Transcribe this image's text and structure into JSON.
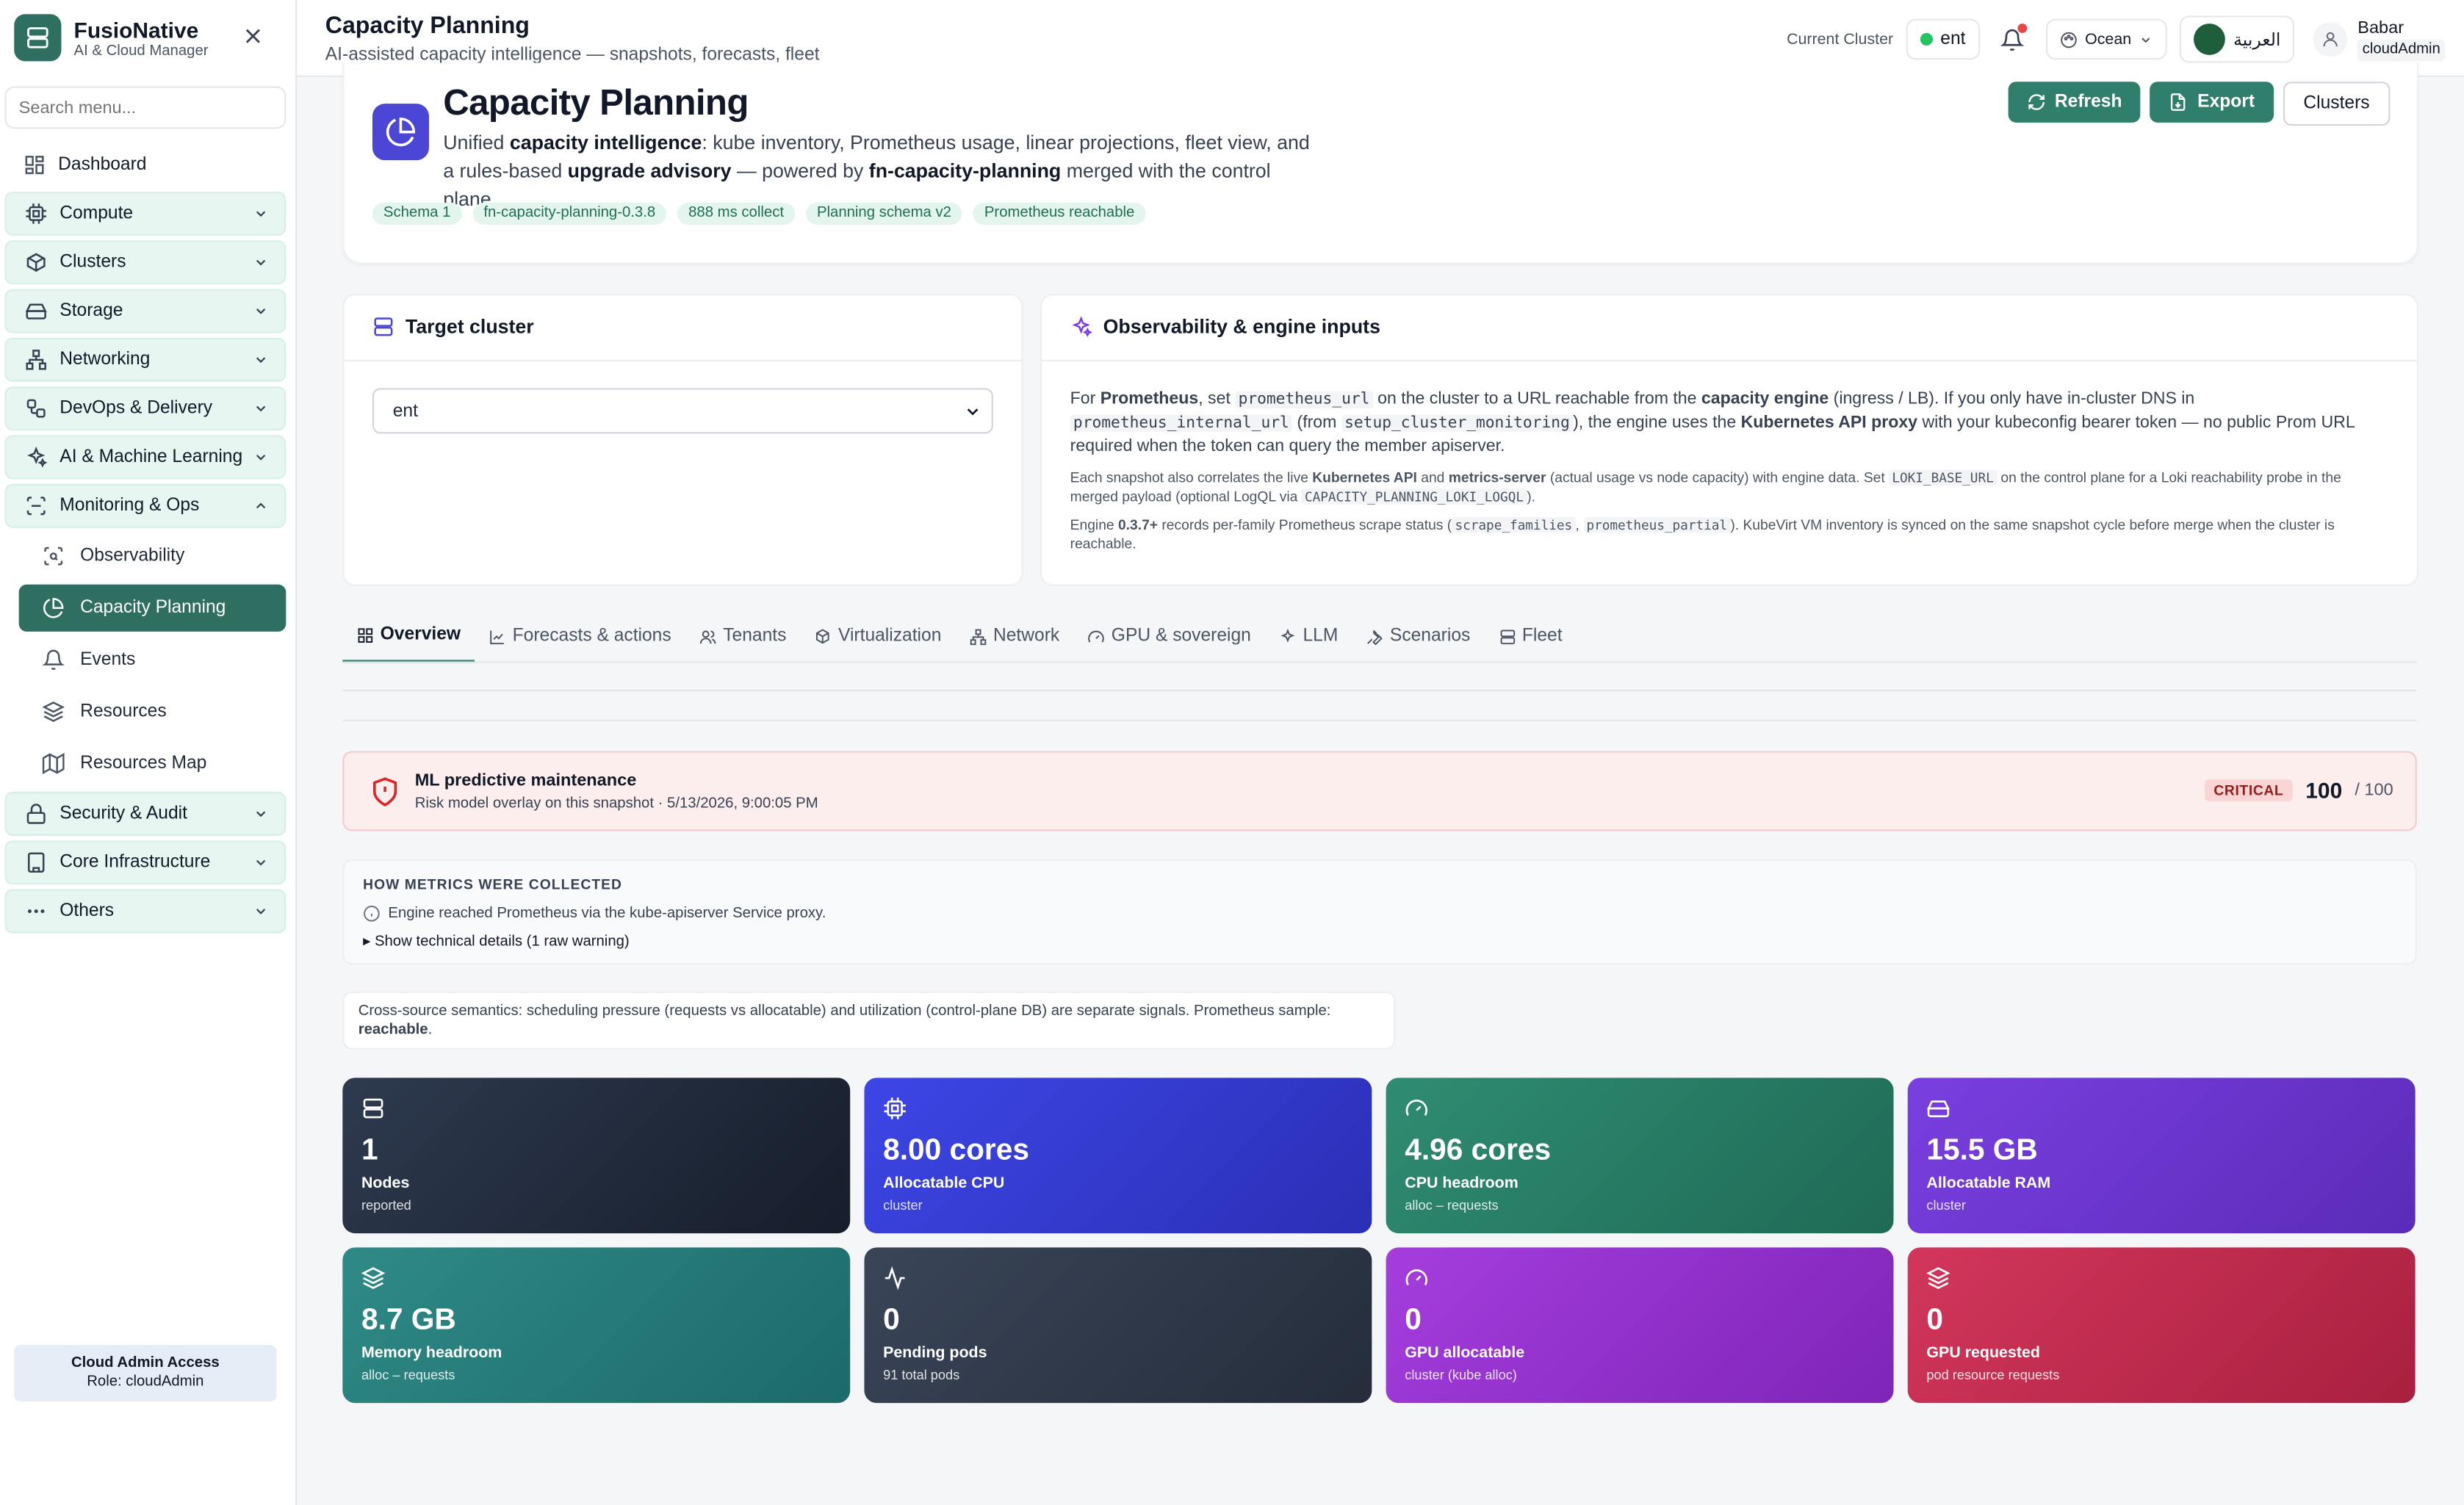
{
  "brand": {
    "name": "FusioNative",
    "subtitle": "AI & Cloud Manager"
  },
  "sidebar": {
    "search_placeholder": "Search menu...",
    "dashboard": "Dashboard",
    "groups": {
      "compute": "Compute",
      "clusters": "Clusters",
      "storage": "Storage",
      "networking": "Networking",
      "devops": "DevOps & Delivery",
      "ai": "AI & Machine Learning",
      "monitoring": "Monitoring & Ops",
      "security": "Security & Audit",
      "core": "Core Infrastructure",
      "others": "Others"
    },
    "sub": {
      "observability": "Observability",
      "capacity": "Capacity Planning",
      "events": "Events",
      "resources": "Resources",
      "resources_map": "Resources Map"
    },
    "admin": {
      "title": "Cloud Admin Access",
      "role": "Role: cloudAdmin"
    }
  },
  "topbar": {
    "title": "Capacity Planning",
    "subtitle": "AI-assisted capacity intelligence — snapshots, forecasts, fleet",
    "cluster_label": "Current Cluster",
    "cluster_value": "ent",
    "theme": "Ocean",
    "lang": "العربية",
    "user_name": "Babar",
    "user_role": "cloudAdmin"
  },
  "header": {
    "title": "Capacity Planning",
    "desc": {
      "t1": "Unified ",
      "b1": "capacity intelligence",
      "t2": ": kube inventory, Prometheus usage, linear projections, fleet view, and a rules-based ",
      "b2": "upgrade advisory",
      "t3": " — powered by ",
      "b3": "fn-capacity-planning",
      "t4": " merged with the control plane."
    },
    "chips": [
      "Schema 1",
      "fn-capacity-planning-0.3.8",
      "888 ms collect",
      "Planning schema v2",
      "Prometheus reachable"
    ],
    "buttons": {
      "refresh": "Refresh",
      "export": "Export",
      "clusters": "Clusters"
    }
  },
  "target": {
    "title": "Target cluster",
    "value": "ent"
  },
  "observability": {
    "title": "Observability & engine inputs",
    "p1": {
      "t1": "For ",
      "b1": "Prometheus",
      "t2": ", set ",
      "c1": "prometheus_url",
      "t3": " on the cluster to a URL reachable from the ",
      "b2": "capacity engine",
      "t4": " (ingress / LB). If you only have in-cluster DNS in ",
      "c2": "prometheus_internal_url",
      "t5": " (from ",
      "c3": "setup_cluster_monitoring",
      "t6": "), the engine uses the ",
      "b3": "Kubernetes API proxy",
      "t7": " with your kubeconfig bearer token — no public Prom URL required when the token can query the member apiserver."
    },
    "p2": {
      "t1": "Each snapshot also correlates the live ",
      "b1": "Kubernetes API",
      "t2": " and ",
      "b2": "metrics-server",
      "t3": " (actual usage vs node capacity) with engine data. Set ",
      "c1": "LOKI_BASE_URL",
      "t4": " on the control plane for a Loki reachability probe in the merged payload (optional LogQL via ",
      "c2": "CAPACITY_PLANNING_LOKI_LOGQL",
      "t5": ")."
    },
    "p3": {
      "t1": "Engine ",
      "b1": "0.3.7+",
      "t2": " records per-family Prometheus scrape status (",
      "c1": "scrape_families",
      "t3": ", ",
      "c2": "prometheus_partial",
      "t4": "). KubeVirt VM inventory is synced on the same snapshot cycle before merge when the cluster is reachable."
    }
  },
  "tabs": [
    "Overview",
    "Forecasts & actions",
    "Tenants",
    "Virtualization",
    "Network",
    "GPU & sovereign",
    "LLM",
    "Scenarios",
    "Fleet"
  ],
  "alert": {
    "title": "ML predictive maintenance",
    "subtitle": "Risk model overlay on this snapshot · 5/13/2026, 9:00:05 PM",
    "badge": "CRITICAL",
    "score": "100",
    "score_max": "/ 100",
    "color": "#dc2626"
  },
  "metrics_info": {
    "heading": "HOW METRICS WERE COLLECTED",
    "line": "Engine reached Prometheus via the kube-apiserver Service proxy.",
    "details": "▸ Show technical details (1 raw warning)"
  },
  "semantics": {
    "text": "Cross-source semantics: scheduling pressure (requests vs allocatable) and utilization (control-plane DB) are separate signals. Prometheus sample: ",
    "bold": "reachable",
    "end": "."
  },
  "cards": [
    {
      "icon": "server-icon",
      "value": "1",
      "label": "Nodes",
      "caption": "reported",
      "from": "#2e3a4f",
      "to": "#161d2b"
    },
    {
      "icon": "cpu-icon",
      "value": "8.00 cores",
      "label": "Allocatable CPU",
      "caption": "cluster",
      "from": "#3d46e6",
      "to": "#2a2fb5"
    },
    {
      "icon": "gauge-icon",
      "value": "4.96 cores",
      "label": "CPU headroom",
      "caption": "alloc – requests",
      "from": "#2f8c72",
      "to": "#1f6a56"
    },
    {
      "icon": "hard-drive-icon",
      "value": "15.5 GB",
      "label": "Allocatable RAM",
      "caption": "cluster",
      "from": "#7a3fe0",
      "to": "#5a2bb8"
    },
    {
      "icon": "layers-icon",
      "value": "8.7 GB",
      "label": "Memory headroom",
      "caption": "alloc – requests",
      "from": "#2f8a86",
      "to": "#1c6a6a"
    },
    {
      "icon": "activity-icon",
      "value": "0",
      "label": "Pending pods",
      "caption": "91 total pods",
      "from": "#3a4558",
      "to": "#252d3b"
    },
    {
      "icon": "gauge-icon",
      "value": "0",
      "label": "GPU allocatable",
      "caption": "cluster (kube alloc)",
      "from": "#a53ddd",
      "to": "#7e25b8"
    },
    {
      "icon": "layers-icon",
      "value": "0",
      "label": "GPU requested",
      "caption": "pod resource requests",
      "from": "#d3365c",
      "to": "#a8203f"
    }
  ]
}
